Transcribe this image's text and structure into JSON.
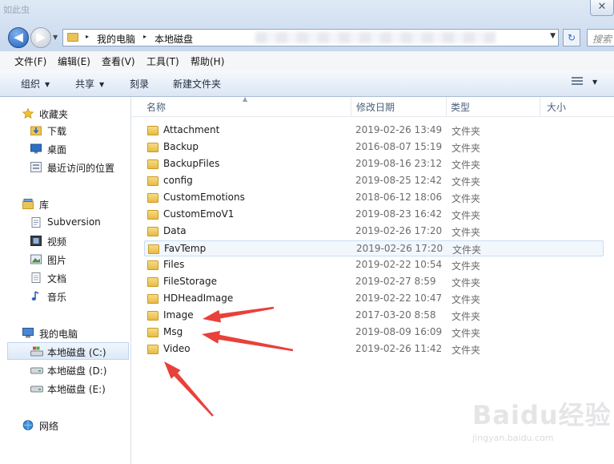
{
  "window": {
    "title_partial": "如此虫",
    "close_symbol": "✕"
  },
  "nav": {
    "back_symbol": "◀",
    "forward_symbol": "▶",
    "history_symbol": "▼"
  },
  "address": {
    "crumbs": [
      "我的电脑",
      "本地磁盘"
    ],
    "separator": "▸",
    "dropdown_symbol": "▼",
    "refresh_symbol": "↻"
  },
  "search": {
    "placeholder": "搜索"
  },
  "menu": {
    "items": [
      "文件(F)",
      "编辑(E)",
      "查看(V)",
      "工具(T)",
      "帮助(H)"
    ]
  },
  "commands": {
    "organize": "组织",
    "share": "共享",
    "burn": "刻录",
    "new_folder": "新建文件夹",
    "caret": "▼"
  },
  "sidebar": {
    "favorites": {
      "label": "收藏夹",
      "icon": "star-icon",
      "items": [
        {
          "label": "下载",
          "icon": "download-folder-icon"
        },
        {
          "label": "桌面",
          "icon": "desktop-icon"
        },
        {
          "label": "最近访问的位置",
          "icon": "recent-places-icon"
        }
      ]
    },
    "libraries": {
      "label": "库",
      "icon": "library-icon",
      "items": [
        {
          "label": "Subversion",
          "icon": "document-library-icon"
        },
        {
          "label": "视频",
          "icon": "video-icon"
        },
        {
          "label": "图片",
          "icon": "picture-icon"
        },
        {
          "label": "文档",
          "icon": "document-icon"
        },
        {
          "label": "音乐",
          "icon": "music-icon"
        }
      ]
    },
    "computer": {
      "label": "我的电脑",
      "icon": "computer-icon",
      "items": [
        {
          "label": "本地磁盘 (C:)",
          "icon": "system-drive-icon",
          "selected": true
        },
        {
          "label": "本地磁盘 (D:)",
          "icon": "drive-icon"
        },
        {
          "label": "本地磁盘 (E:)",
          "icon": "drive-icon"
        }
      ]
    },
    "network": {
      "label": "网络",
      "icon": "network-icon"
    }
  },
  "columns": {
    "name": "名称",
    "date": "修改日期",
    "type": "类型",
    "size": "大小",
    "sort_symbol": "▲"
  },
  "files": [
    {
      "name": "Attachment",
      "date": "2019-02-26 13:49",
      "type": "文件夹"
    },
    {
      "name": "Backup",
      "date": "2016-08-07 15:19",
      "type": "文件夹"
    },
    {
      "name": "BackupFiles",
      "date": "2019-08-16 23:12",
      "type": "文件夹"
    },
    {
      "name": "config",
      "date": "2019-08-25 12:42",
      "type": "文件夹"
    },
    {
      "name": "CustomEmotions",
      "date": "2018-06-12 18:06",
      "type": "文件夹"
    },
    {
      "name": "CustomEmoV1",
      "date": "2019-08-23 16:42",
      "type": "文件夹"
    },
    {
      "name": "Data",
      "date": "2019-02-26 17:20",
      "type": "文件夹"
    },
    {
      "name": "FavTemp",
      "date": "2019-02-26 17:20",
      "type": "文件夹",
      "hover": true
    },
    {
      "name": "Files",
      "date": "2019-02-22 10:54",
      "type": "文件夹"
    },
    {
      "name": "FileStorage",
      "date": "2019-02-27 8:59",
      "type": "文件夹"
    },
    {
      "name": "HDHeadImage",
      "date": "2019-02-22 10:47",
      "type": "文件夹"
    },
    {
      "name": "Image",
      "date": "2017-03-20 8:58",
      "type": "文件夹"
    },
    {
      "name": "Msg",
      "date": "2019-08-09 16:09",
      "type": "文件夹"
    },
    {
      "name": "Video",
      "date": "2019-02-26 11:42",
      "type": "文件夹"
    }
  ],
  "annotation": {
    "arrow_color": "#e8413a"
  },
  "watermark": {
    "brand": "Baidu经验",
    "url": "jingyan.baidu.com"
  }
}
